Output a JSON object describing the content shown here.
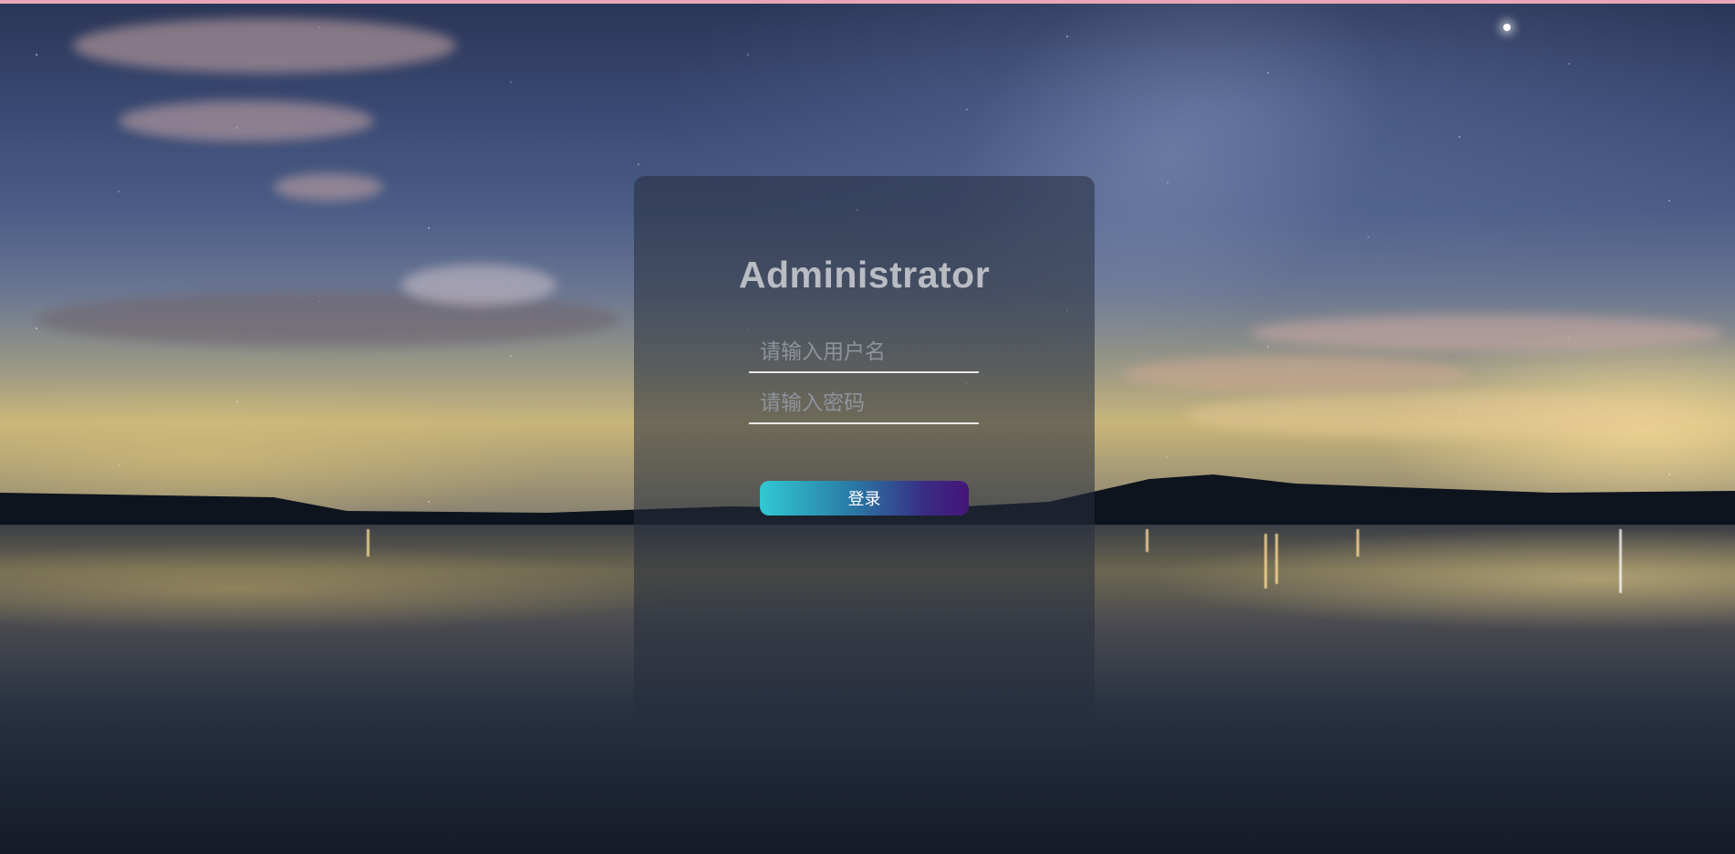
{
  "login": {
    "title": "Administrator",
    "username_placeholder": "请输入用户名",
    "password_placeholder": "请输入密码",
    "submit_label": "登录"
  },
  "colors": {
    "top_accent": "#e9a6b8",
    "button_gradient_start": "#30c9d2",
    "button_gradient_end": "#45157a",
    "panel": "#262d3c",
    "title_text": "#b9bcc3"
  },
  "icons": {
    "background": "night-lake-landscape-image"
  }
}
